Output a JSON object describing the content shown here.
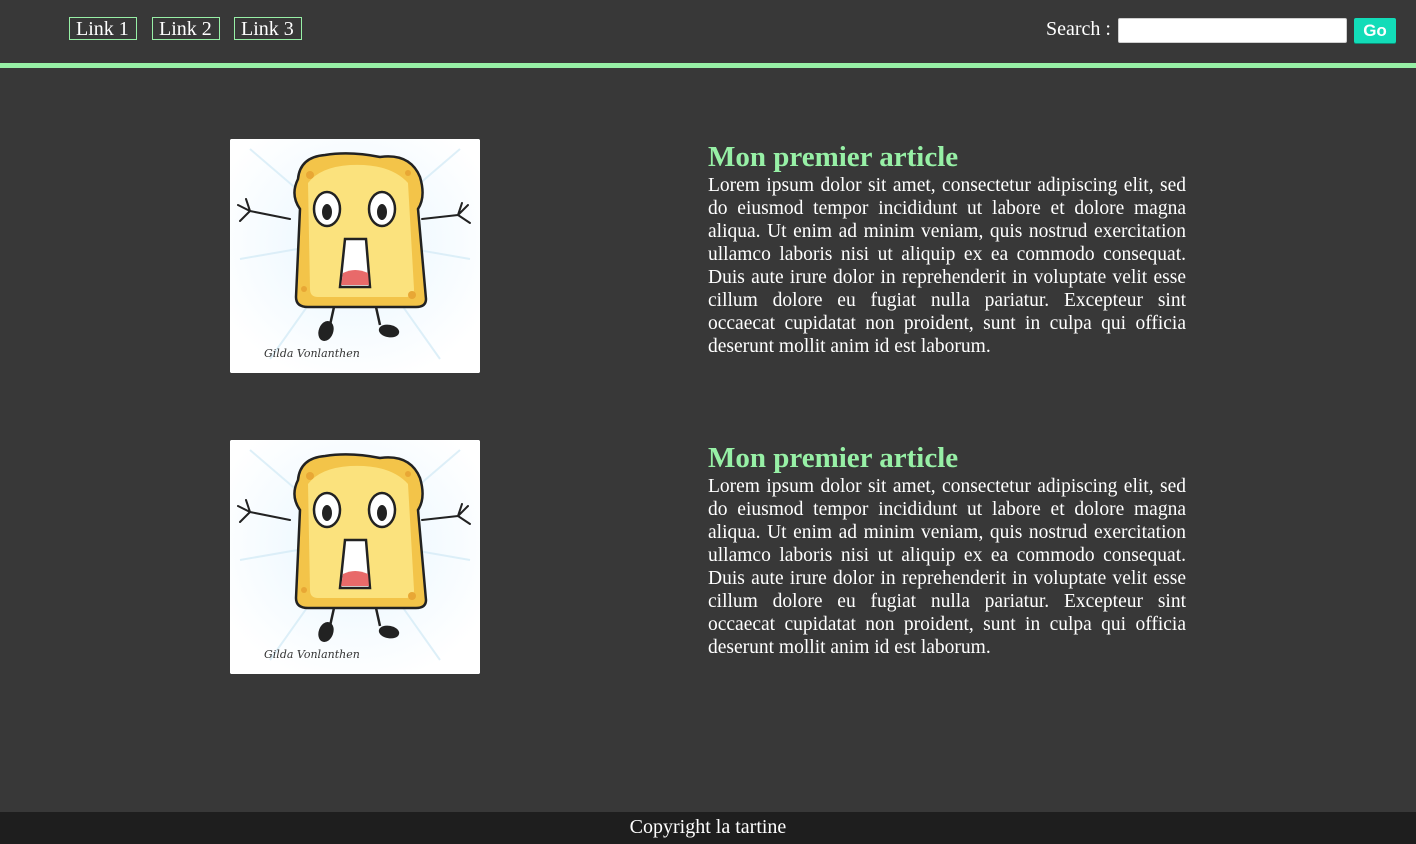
{
  "nav": {
    "links": [
      {
        "label": "Link 1"
      },
      {
        "label": "Link 2"
      },
      {
        "label": "Link 3"
      }
    ]
  },
  "search": {
    "label": "Search :",
    "value": "",
    "button_label": "Go"
  },
  "articles": [
    {
      "title": "Mon premier article",
      "body": "Lorem ipsum dolor sit amet, consectetur adipiscing elit, sed do eiusmod tempor incididunt ut labore et dolore magna aliqua. Ut enim ad minim veniam, quis nostrud exercitation ullamco laboris nisi ut aliquip ex ea commodo consequat. Duis aute irure dolor in reprehenderit in voluptate velit esse cillum dolore eu fugiat nulla pariatur. Excepteur sint occaecat cupidatat non proident, sunt in culpa qui officia deserunt mollit anim id est laborum.",
      "image_signature": "Gilda Vonlanthen"
    },
    {
      "title": "Mon premier article",
      "body": "Lorem ipsum dolor sit amet, consectetur adipiscing elit, sed do eiusmod tempor incididunt ut labore et dolore magna aliqua. Ut enim ad minim veniam, quis nostrud exercitation ullamco laboris nisi ut aliquip ex ea commodo consequat. Duis aute irure dolor in reprehenderit in voluptate velit esse cillum dolore eu fugiat nulla pariatur. Excepteur sint occaecat cupidatat non proident, sunt in culpa qui officia deserunt mollit anim id est laborum.",
      "image_signature": "Gilda Vonlanthen"
    }
  ],
  "footer": {
    "text": "Copyright la tartine"
  },
  "colors": {
    "background": "#383838",
    "accent": "#97f0a6",
    "go_button": "#12dcb8",
    "footer_bg": "#1e1e1e"
  }
}
